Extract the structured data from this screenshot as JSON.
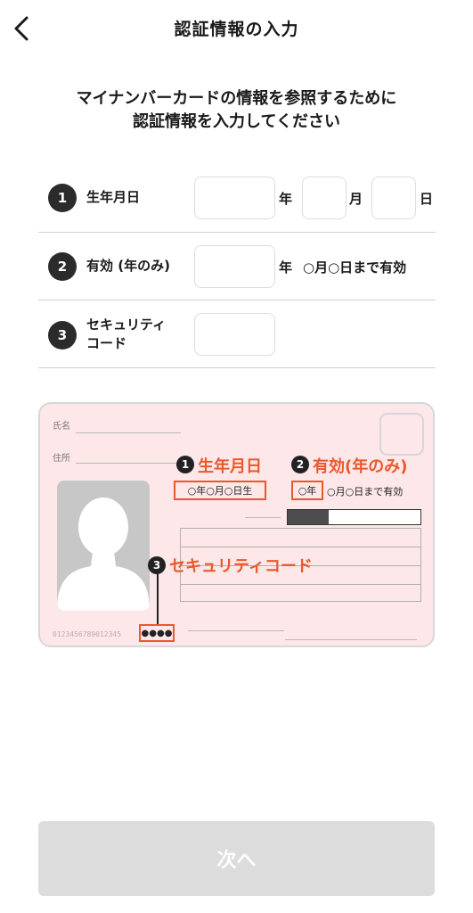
{
  "header": {
    "title": "認証情報の入力",
    "back_icon": "chevron-left-icon"
  },
  "instructions": {
    "line1": "マイナンバーカードの情報を参照するために",
    "line2": "認証情報を入力してください"
  },
  "form": {
    "rows": [
      {
        "number": "1",
        "label": "生年月日",
        "year_unit": "年",
        "month_unit": "月",
        "day_unit": "日",
        "year_value": "",
        "month_value": "",
        "day_value": ""
      },
      {
        "number": "2",
        "label": "有効 (年のみ)",
        "year_unit": "年",
        "suffix": "○月○日まで有効",
        "year_value": ""
      },
      {
        "number": "3",
        "label_line1": "セキュリティ",
        "label_line2": "コード",
        "value": ""
      }
    ]
  },
  "card": {
    "name_label": "氏名",
    "address_label": "住所",
    "serial": "0123456789012345",
    "birth_label": "生年月日",
    "birth_text": "○年○月○日生",
    "expiry_label": "有効(年のみ)",
    "expiry_year_text": "○年",
    "expiry_rest_text": "○月○日まで有効",
    "security_label": "セキュリティコード",
    "security_dots": "●●●●",
    "badge1": "1",
    "badge2": "2",
    "badge3": "3",
    "accent_color": "#e8592a"
  },
  "next_button": {
    "label": "次へ"
  }
}
